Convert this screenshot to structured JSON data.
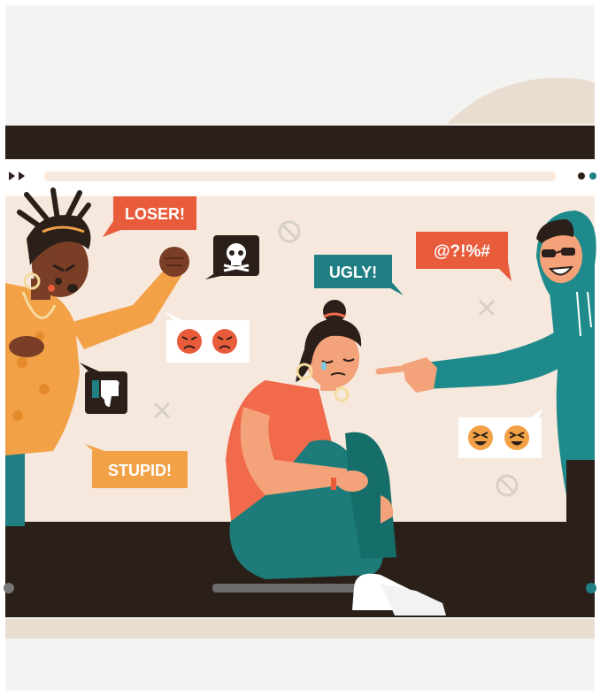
{
  "bubbles": {
    "loser": "LOSER!",
    "ugly": "UGLY!",
    "symbols": "@?!%#",
    "stupid": "STUPID!"
  },
  "icons": [
    "skull-icon",
    "thumbs-down-icon",
    "angry-face-icon",
    "laughing-face-icon",
    "prohibited-icon",
    "close-icon",
    "play-icon"
  ],
  "colors": {
    "background": "#f3f3f1",
    "frame": "#2b2019",
    "screen": "#f6e8dc",
    "red_bubble": "#e85c3c",
    "teal_bubble": "#1f7f83",
    "orange_bubble": "#f2a147",
    "hoodie": "#1f8a8b",
    "shirt": "#f06a4b",
    "jeans": "#1d7c79",
    "skin_dark": "#7a3d25"
  }
}
